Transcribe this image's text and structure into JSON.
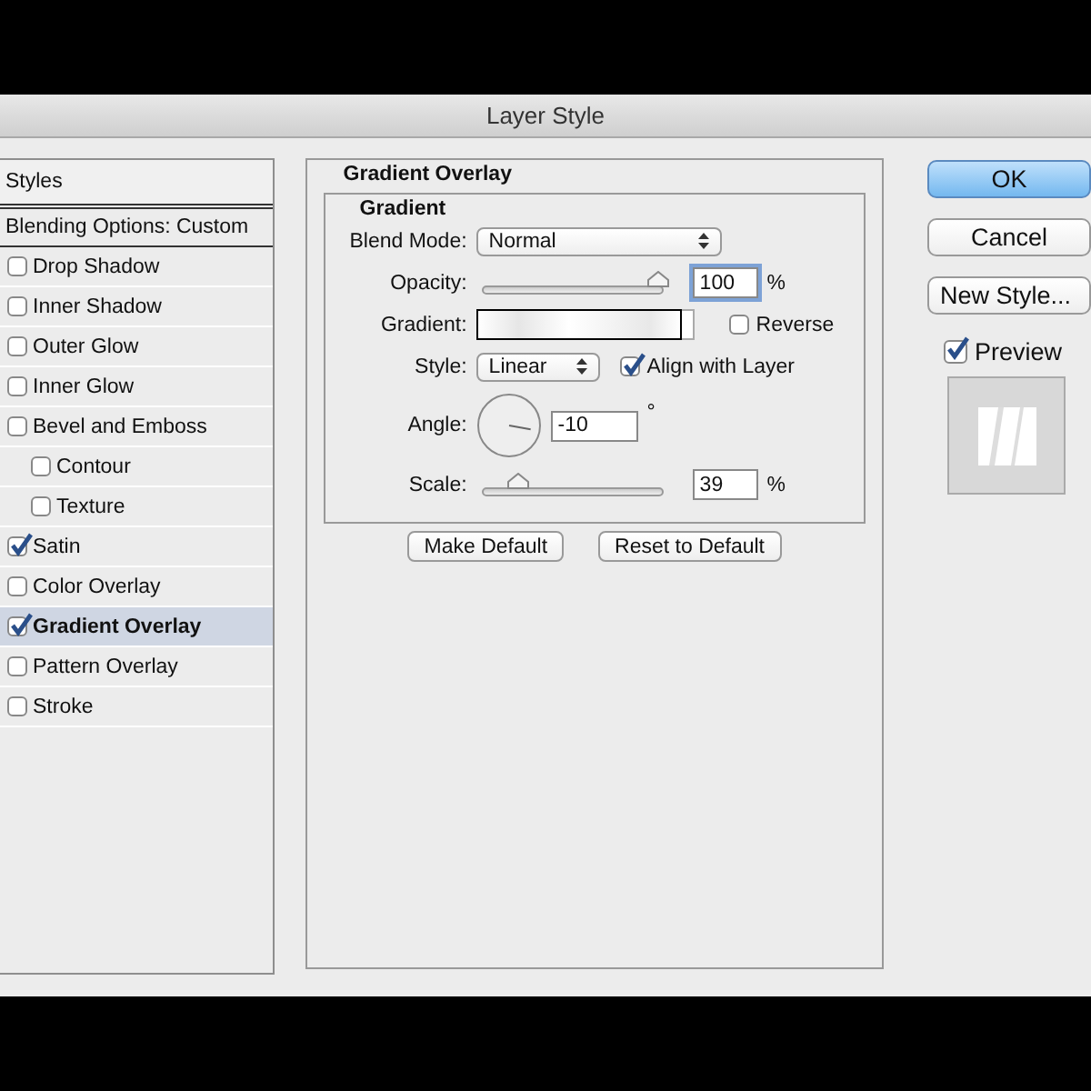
{
  "window": {
    "title": "Layer Style"
  },
  "styles_panel": {
    "header": "Styles",
    "blending_options": "Blending Options: Custom",
    "items": [
      {
        "label": "Drop Shadow",
        "checked": false,
        "selected": false
      },
      {
        "label": "Inner Shadow",
        "checked": false,
        "selected": false
      },
      {
        "label": "Outer Glow",
        "checked": false,
        "selected": false
      },
      {
        "label": "Inner Glow",
        "checked": false,
        "selected": false
      },
      {
        "label": "Bevel and Emboss",
        "checked": false,
        "selected": false,
        "children": [
          {
            "label": "Contour",
            "checked": false,
            "selected": false
          },
          {
            "label": "Texture",
            "checked": false,
            "selected": false
          }
        ]
      },
      {
        "label": "Satin",
        "checked": true,
        "selected": false
      },
      {
        "label": "Color Overlay",
        "checked": false,
        "selected": false
      },
      {
        "label": "Gradient Overlay",
        "checked": true,
        "selected": true
      },
      {
        "label": "Pattern Overlay",
        "checked": false,
        "selected": false
      },
      {
        "label": "Stroke",
        "checked": false,
        "selected": false
      }
    ]
  },
  "gradient_overlay": {
    "title": "Gradient Overlay",
    "group_title": "Gradient",
    "blend_mode": {
      "label": "Blend Mode:",
      "value": "Normal"
    },
    "opacity": {
      "label": "Opacity:",
      "level": 1.0,
      "value": "100",
      "unit": "%"
    },
    "gradient": {
      "label": "Gradient:",
      "reverse": {
        "label": "Reverse",
        "checked": false
      }
    },
    "style": {
      "label": "Style:",
      "value": "Linear",
      "align_with_layer": {
        "label": "Align with Layer",
        "checked": true
      }
    },
    "angle": {
      "label": "Angle:",
      "value": "-10",
      "unit": "°"
    },
    "scale": {
      "label": "Scale:",
      "level": 0.18,
      "value": "39",
      "unit": "%"
    },
    "buttons": [
      "Make Default",
      "Reset to Default"
    ]
  },
  "actions": {
    "ok": "OK",
    "cancel": "Cancel",
    "new_style": "New Style...",
    "preview": {
      "label": "Preview",
      "checked": true
    }
  }
}
